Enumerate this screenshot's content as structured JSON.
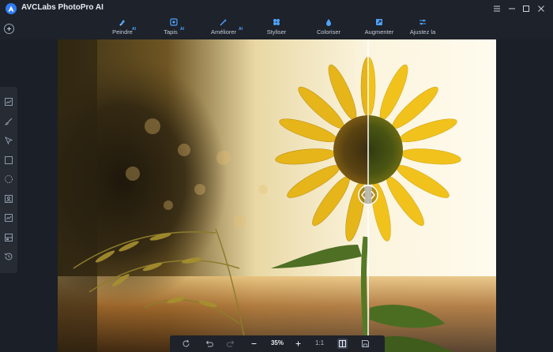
{
  "app": {
    "title": "AVCLabs PhotoPro AI"
  },
  "toolbar": {
    "tools": [
      {
        "label": "Peindre",
        "badge": "AI",
        "icon": "paint-icon"
      },
      {
        "label": "Tapis",
        "badge": "AI",
        "icon": "mat-icon"
      },
      {
        "label": "Améliorer",
        "badge": "AI",
        "icon": "enhance-icon"
      },
      {
        "label": "Styliser",
        "badge": "",
        "icon": "stylize-icon"
      },
      {
        "label": "Coloriser",
        "badge": "",
        "icon": "colorize-icon"
      },
      {
        "label": "Augmenter",
        "badge": "",
        "icon": "upscale-icon"
      },
      {
        "label": "Ajustez la",
        "badge": "",
        "icon": "adjust-icon"
      }
    ]
  },
  "sidebar": {
    "tools": [
      "chart-icon",
      "brush-icon",
      "pointer-icon",
      "rectangle-icon",
      "lasso-icon",
      "portrait-icon",
      "image-icon",
      "compare-icon",
      "history-icon"
    ]
  },
  "bottombar": {
    "zoom": "35%",
    "ratio": "1:1"
  },
  "colors": {
    "accent": "#2f7cf6",
    "badge": "#4ea3ff",
    "background": "#1b1f27"
  }
}
